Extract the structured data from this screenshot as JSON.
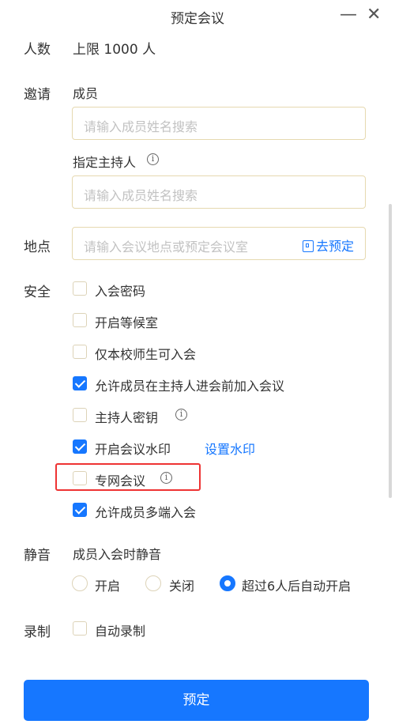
{
  "window": {
    "title": "预定会议",
    "minimize_icon": "minimize-icon",
    "close_icon": "close-icon"
  },
  "capacity": {
    "label": "人数",
    "value": "上限 1000 人"
  },
  "invite": {
    "label": "邀请",
    "members_label": "成员",
    "members_placeholder": "请输入成员姓名搜索",
    "host_label": "指定主持人",
    "host_placeholder": "请输入成员姓名搜索"
  },
  "location": {
    "label": "地点",
    "placeholder": "请输入会议地点或预定会议室",
    "book_label": "去预定"
  },
  "security": {
    "label": "安全",
    "options": [
      {
        "label": "入会密码",
        "checked": false
      },
      {
        "label": "开启等候室",
        "checked": false
      },
      {
        "label": "仅本校师生可入会",
        "checked": false
      },
      {
        "label": "允许成员在主持人进会前加入会议",
        "checked": true
      },
      {
        "label": "主持人密钥",
        "checked": false
      },
      {
        "label": "开启会议水印",
        "checked": true
      },
      {
        "label": "专网会议",
        "checked": false
      },
      {
        "label": "允许成员多端入会",
        "checked": true
      }
    ],
    "watermark_link": "设置水印"
  },
  "mute": {
    "label": "静音",
    "sublabel": "成员入会时静音",
    "options": [
      {
        "label": "开启",
        "selected": false
      },
      {
        "label": "关闭",
        "selected": false
      },
      {
        "label": "超过6人后自动开启",
        "selected": true
      }
    ]
  },
  "record": {
    "label": "录制",
    "option": {
      "label": "自动录制",
      "checked": false
    }
  },
  "submit_label": "预定",
  "colors": {
    "accent": "#1677ff",
    "highlight": "#e33333"
  }
}
